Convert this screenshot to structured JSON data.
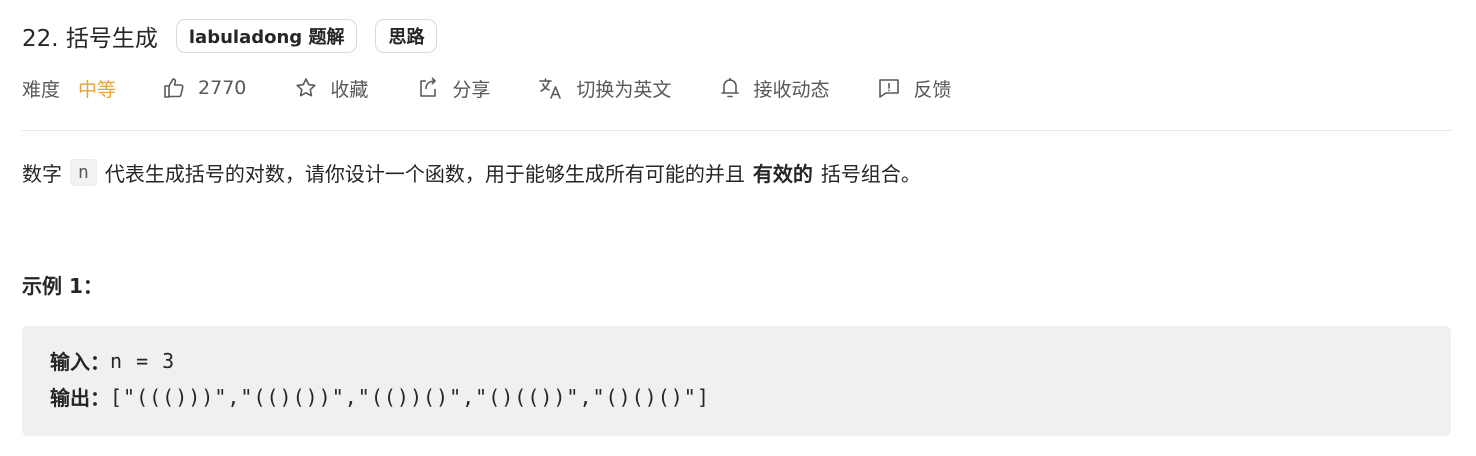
{
  "problem": {
    "title": "22. 括号生成",
    "tags": [
      "labuladong 题解",
      "思路"
    ]
  },
  "meta": {
    "difficulty_label": "难度",
    "difficulty_value": "中等",
    "likes": "2770",
    "favorite_label": "收藏",
    "share_label": "分享",
    "switch_lang_label": "切换为英文",
    "notify_label": "接收动态",
    "feedback_label": "反馈",
    "icons": [
      "thumbs-up-icon",
      "star-icon",
      "share-icon",
      "translate-icon",
      "bell-icon",
      "feedback-icon"
    ],
    "difficulty_color": "#e8a33a"
  },
  "description": {
    "prefix": "数字",
    "code": "n",
    "middle": "代表生成括号的对数，请你设计一个函数，用于能够生成所有可能的并且",
    "bold": "有效的",
    "suffix": "括号组合。"
  },
  "example": {
    "title": "示例 1：",
    "input_label": "输入：",
    "input_value": "n = 3",
    "output_label": "输出：",
    "output_value": "[\"((()))\",\"(()())\",\"(())()\",\"()(())\",\"()()()\"]"
  }
}
